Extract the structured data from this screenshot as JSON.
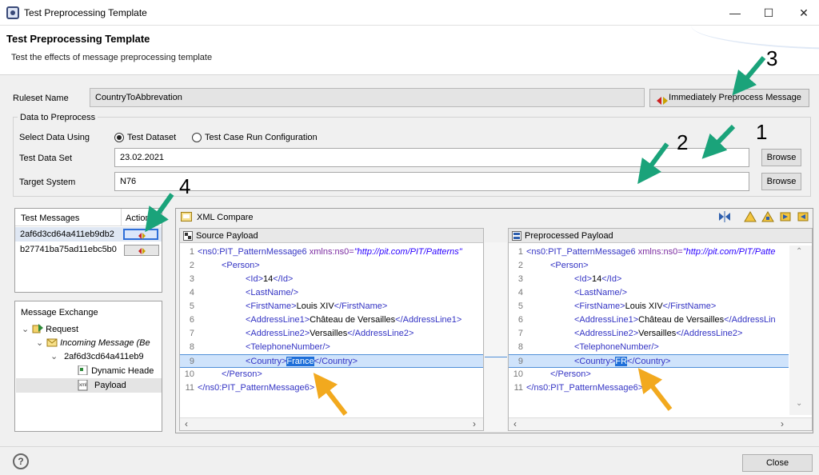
{
  "window": {
    "title": "Test Preprocessing Template",
    "minimize_glyph": "—",
    "maximize_glyph": "☐",
    "close_glyph": "✕"
  },
  "header": {
    "title": "Test Preprocessing Template",
    "subtitle": "Test the effects of message preprocessing template"
  },
  "ruleset": {
    "label": "Ruleset Name",
    "value": "CountryToAbbrevation",
    "preprocess_button": "Immediately Preprocess Message"
  },
  "data_group": {
    "title": "Data to Preprocess",
    "select_label": "Select Data Using",
    "radio_test_dataset": "Test Dataset",
    "radio_test_case": "Test Case Run Configuration",
    "test_data_set_label": "Test Data Set",
    "test_data_set_value": "23.02.2021",
    "target_system_label": "Target System",
    "target_system_value": "N76",
    "browse_label": "Browse"
  },
  "test_messages": {
    "col_messages": "Test Messages",
    "col_action": "Action",
    "rows": [
      "2af6d3cd64a411eb9db2",
      "b27741ba75ad11ebc5b0"
    ]
  },
  "message_exchange": {
    "title": "Message Exchange",
    "request": "Request",
    "incoming": "Incoming Message (Be",
    "message_id": "2af6d3cd64a411eb9",
    "dynamic_header": "Dynamic Heade",
    "payload": "Payload",
    "xml_badge": "xml"
  },
  "xml_compare": {
    "title": "XML Compare",
    "source_title": "Source Payload",
    "preprocessed_title": "Preprocessed Payload"
  },
  "source_lines": [
    {
      "n": "1",
      "indent": 0,
      "open": "<ns0:PIT_PatternMessage6",
      "attr": "xmlns:ns0=",
      "val": "\"http://pit.com/PIT/Patterns\"",
      "close": ""
    },
    {
      "n": "2",
      "indent": 1,
      "open": "<Person>"
    },
    {
      "n": "3",
      "indent": 2,
      "open": "<Id>",
      "text": "14",
      "close": "</Id>"
    },
    {
      "n": "4",
      "indent": 2,
      "open": "<LastName/>"
    },
    {
      "n": "5",
      "indent": 2,
      "open": "<FirstName>",
      "text": "Louis XIV",
      "close": "</FirstName>"
    },
    {
      "n": "6",
      "indent": 2,
      "open": "<AddressLine1>",
      "text": "Château de Versailles",
      "close": "</AddressLine1>"
    },
    {
      "n": "7",
      "indent": 2,
      "open": "<AddressLine2>",
      "text": "Versailles",
      "close": "</AddressLine2>"
    },
    {
      "n": "8",
      "indent": 2,
      "open": "<TelephoneNumber/>"
    },
    {
      "n": "9",
      "indent": 2,
      "open": "<Country>",
      "highlight": "France",
      "close": "</Country>"
    },
    {
      "n": "10",
      "indent": 1,
      "open": "</Person>"
    },
    {
      "n": "11",
      "indent": 0,
      "open": "</ns0:PIT_PatternMessage6>"
    }
  ],
  "preprocessed_lines": [
    {
      "n": "1",
      "indent": 0,
      "open": "<ns0:PIT_PatternMessage6",
      "attr": "xmlns:ns0=",
      "val": "\"http://pit.com/PIT/Patte",
      "close": ""
    },
    {
      "n": "2",
      "indent": 1,
      "open": "<Person>"
    },
    {
      "n": "3",
      "indent": 2,
      "open": "<Id>",
      "text": "14",
      "close": "</Id>"
    },
    {
      "n": "4",
      "indent": 2,
      "open": "<LastName/>"
    },
    {
      "n": "5",
      "indent": 2,
      "open": "<FirstName>",
      "text": "Louis XIV",
      "close": "</FirstName>"
    },
    {
      "n": "6",
      "indent": 2,
      "open": "<AddressLine1>",
      "text": "Château de Versailles",
      "close": "</AddressLin"
    },
    {
      "n": "7",
      "indent": 2,
      "open": "<AddressLine2>",
      "text": "Versailles",
      "close": "</AddressLine2>"
    },
    {
      "n": "8",
      "indent": 2,
      "open": "<TelephoneNumber/>"
    },
    {
      "n": "9",
      "indent": 2,
      "open": "<Country>",
      "highlight": "FR",
      "close": "</Country>"
    },
    {
      "n": "10",
      "indent": 1,
      "open": "</Person>"
    },
    {
      "n": "11",
      "indent": 0,
      "open": "</ns0:PIT_PatternMessage6>"
    }
  ],
  "annotations": {
    "one": "1",
    "two": "2",
    "three": "3",
    "four": "4"
  },
  "footer": {
    "help_glyph": "?",
    "close_label": "Close"
  },
  "colors": {
    "annotation_green": "#1aa37a",
    "annotation_orange": "#f2a91e",
    "selection_blue": "#1e6fd9"
  }
}
